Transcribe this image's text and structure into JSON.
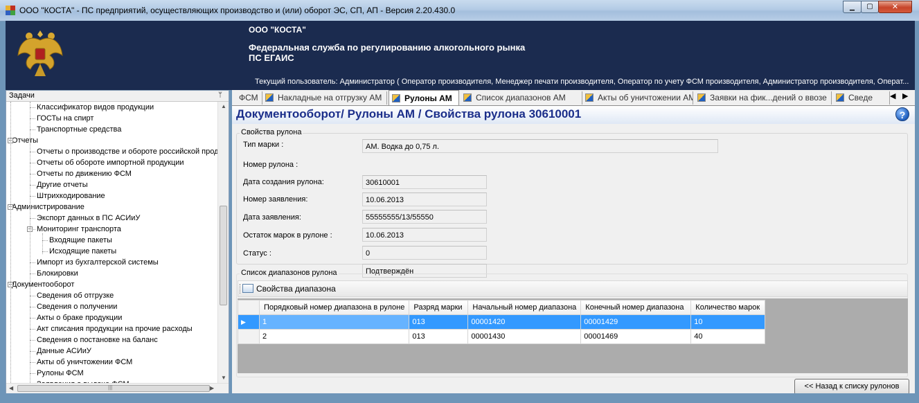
{
  "window": {
    "title": "ООО \"КОСТА\" - ПС предприятий, осуществляющих производство и (или) оборот ЭС, СП, АП - Версия 2.20.430.0",
    "minimize_glyph": "▁",
    "maximize_glyph": "▢",
    "close_glyph": "✕"
  },
  "header": {
    "org_name": "ООО \"КОСТА\"",
    "agency_line1": "Федеральная служба по регулированию алкогольного рынка",
    "agency_line2": "ПС ЕГАИС",
    "current_user": "Текущий пользователь: Администратор ( Оператор производителя, Менеджер печати производителя, Оператор по учету ФСМ производителя, Администратор производителя, Операт..."
  },
  "tasks_panel": {
    "title": "Задачи",
    "pin_glyph": "ᛘ",
    "items": [
      {
        "label": "Классификатор видов продукции",
        "level": 2
      },
      {
        "label": "ГОСТы на спирт",
        "level": 2
      },
      {
        "label": "Транспортные средства",
        "level": 2
      },
      {
        "label": "Отчеты",
        "level": 1,
        "expander": "−"
      },
      {
        "label": "Отчеты о производстве и обороте российской прод",
        "level": 2
      },
      {
        "label": "Отчеты об обороте импортной продукции",
        "level": 2
      },
      {
        "label": "Отчеты по движению ФСМ",
        "level": 2
      },
      {
        "label": "Другие отчеты",
        "level": 2
      },
      {
        "label": "Штрихкодирование",
        "level": 2
      },
      {
        "label": "Администрирование",
        "level": 1,
        "expander": "−"
      },
      {
        "label": "Экспорт данных в ПС АСИиУ",
        "level": 2
      },
      {
        "label": "Мониторинг транспорта",
        "level": 2,
        "expander": "−"
      },
      {
        "label": "Входящие пакеты",
        "level": 3
      },
      {
        "label": "Исходящие пакеты",
        "level": 3
      },
      {
        "label": "Импорт из бухгалтерской системы",
        "level": 2
      },
      {
        "label": "Блокировки",
        "level": 2
      },
      {
        "label": "Документооборот",
        "level": 1,
        "expander": "−"
      },
      {
        "label": "Сведения об отгрузке",
        "level": 2
      },
      {
        "label": "Сведения о получении",
        "level": 2
      },
      {
        "label": "Акты о браке продукции",
        "level": 2
      },
      {
        "label": "Акт списания продукции на прочие расходы",
        "level": 2
      },
      {
        "label": "Сведения о постановке на баланс",
        "level": 2
      },
      {
        "label": "Данные АСИиУ",
        "level": 2
      },
      {
        "label": "Акты об уничтожении ФСМ",
        "level": 2
      },
      {
        "label": "Рулоны ФСМ",
        "level": 2
      },
      {
        "label": "Заявления о выдаче ФСМ",
        "level": 2
      }
    ],
    "scroll_up": "▲",
    "scroll_down": "▼",
    "scroll_left": "◀",
    "scroll_right": "▶",
    "hscroll_grip": "|||"
  },
  "tabs": {
    "items": [
      {
        "label": "ФСМ",
        "active": false,
        "icon": false
      },
      {
        "label": "Накладные на отгрузку АМ",
        "active": false,
        "icon": true
      },
      {
        "label": "Рулоны АМ",
        "active": true,
        "icon": true
      },
      {
        "label": "Список диапазонов АМ",
        "active": false,
        "icon": true
      },
      {
        "label": "Акты об уничтожении АМ",
        "active": false,
        "icon": true
      },
      {
        "label": "Заявки на фик...дений о ввозе",
        "active": false,
        "icon": true
      },
      {
        "label": "Сведе",
        "active": false,
        "icon": true
      }
    ],
    "prev_glyph": "◀",
    "next_glyph": "▶"
  },
  "breadcrumb": {
    "text": "Документооборот/ Рулоны АМ / Свойства рулона 30610001",
    "help_glyph": "?"
  },
  "roll_properties": {
    "legend": "Свойства рулона",
    "fields": [
      {
        "label": "Тип марки :",
        "value": "АМ. Водка до 0,75 л."
      },
      {
        "label": "Номер рулона :",
        "value": "30610001"
      },
      {
        "label": "Дата создания рулона:",
        "value": "10.06.2013"
      },
      {
        "label": "Номер заявления:",
        "value": "55555555/13/55550"
      },
      {
        "label": "Дата заявления:",
        "value": "10.06.2013"
      },
      {
        "label": "Остаток марок в рулоне :",
        "value": "0"
      },
      {
        "label": "Статус :",
        "value": "Подтверждён"
      }
    ]
  },
  "ranges": {
    "legend": "Список диапазонов рулона",
    "toolbar_button": "Свойства диапазона",
    "columns": [
      "Порядковый номер диапазона в рулоне",
      "Разряд марки",
      "Начальный номер диапазона",
      "Конечный номер диапазона",
      "Количество марок"
    ],
    "rows": [
      {
        "cells": [
          "1",
          "013",
          "00001420",
          "00001429",
          "10"
        ],
        "selected": true,
        "marker": "▶"
      },
      {
        "cells": [
          "2",
          "013",
          "00001430",
          "00001469",
          "40"
        ],
        "selected": false,
        "marker": ""
      }
    ]
  },
  "footer": {
    "back_button": "<< Назад к списку рулонов"
  }
}
